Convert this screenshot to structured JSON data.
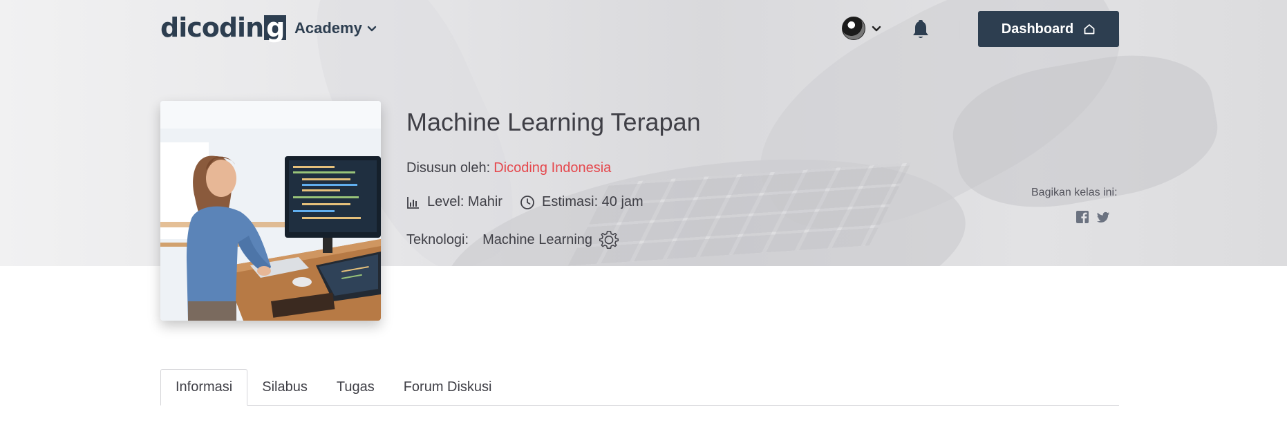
{
  "nav": {
    "logo_text": "dicodin",
    "logo_g": "g",
    "academy_label": "Academy",
    "dashboard_label": "Dashboard"
  },
  "course": {
    "title": "Machine Learning Terapan",
    "author_label": "Disusun oleh:",
    "author_name": "Dicoding Indonesia",
    "level": "Level: Mahir",
    "estimation": "Estimasi: 40 jam",
    "tech_label": "Teknologi:",
    "tech_name": "Machine Learning"
  },
  "share": {
    "label": "Bagikan kelas ini:"
  },
  "tabs": [
    {
      "label": "Informasi",
      "active": true
    },
    {
      "label": "Silabus",
      "active": false
    },
    {
      "label": "Tugas",
      "active": false
    },
    {
      "label": "Forum Diskusi",
      "active": false
    }
  ],
  "colors": {
    "brand": "#2d3e50",
    "author_link": "#e5484d",
    "text": "#3f3f46"
  }
}
